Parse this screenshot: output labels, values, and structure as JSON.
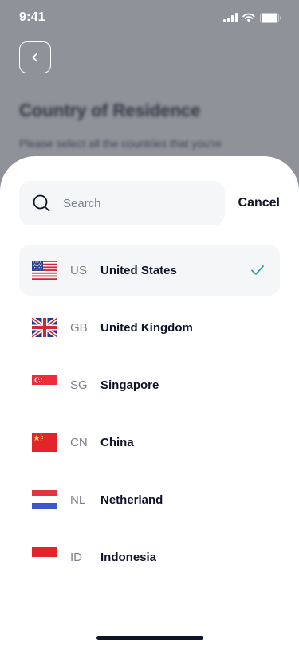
{
  "status_bar": {
    "time": "9:41"
  },
  "background": {
    "title": "Country of Residence",
    "subtitle": "Please select all the countries that you're"
  },
  "sheet": {
    "search": {
      "placeholder": "Search",
      "value": ""
    },
    "cancel_label": "Cancel",
    "countries": [
      {
        "code": "US",
        "name": "United States",
        "flag": "us-flag",
        "selected": true
      },
      {
        "code": "GB",
        "name": "United Kingdom",
        "flag": "gb-flag",
        "selected": false
      },
      {
        "code": "SG",
        "name": "Singapore",
        "flag": "sg-flag",
        "selected": false
      },
      {
        "code": "CN",
        "name": "China",
        "flag": "cn-flag",
        "selected": false
      },
      {
        "code": "NL",
        "name": "Netherland",
        "flag": "nl-flag",
        "selected": false
      },
      {
        "code": "ID",
        "name": "Indonesia",
        "flag": "id-flag",
        "selected": false
      }
    ]
  },
  "colors": {
    "accent_check": "#1fa3a8",
    "text_primary": "#0f1528",
    "text_secondary": "#7a7f8c",
    "field_background": "#f5f6f8"
  }
}
